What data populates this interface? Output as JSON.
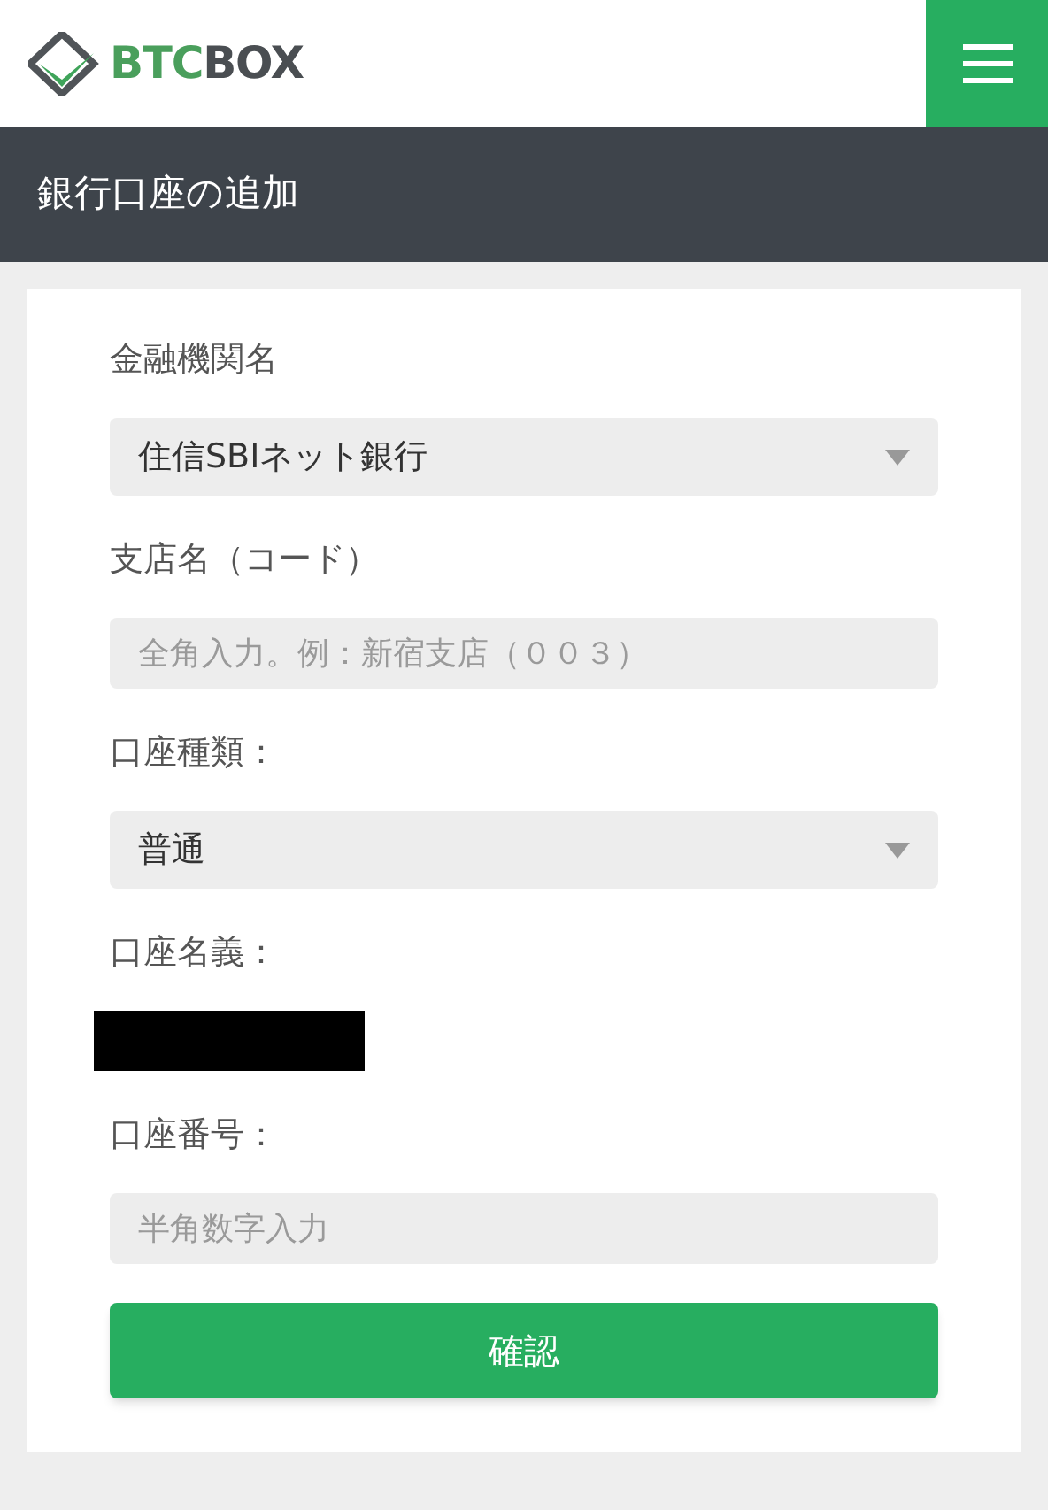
{
  "header": {
    "logo": {
      "part_1": "BTC",
      "part_2": "BOX"
    }
  },
  "title_bar": {
    "title": "銀行口座の追加"
  },
  "form": {
    "fields": [
      {
        "kind": "select",
        "label": "金融機関名",
        "value": "住信SBIネット銀行"
      },
      {
        "kind": "text",
        "label": "支店名（コード）",
        "placeholder": "全角入力。例：新宿支店（００３）"
      },
      {
        "kind": "select",
        "label": "口座種類：",
        "value": "普通"
      },
      {
        "kind": "redacted",
        "label": "口座名義："
      },
      {
        "kind": "text",
        "label": "口座番号：",
        "placeholder": "半角数字入力"
      }
    ],
    "submit": "確認"
  }
}
